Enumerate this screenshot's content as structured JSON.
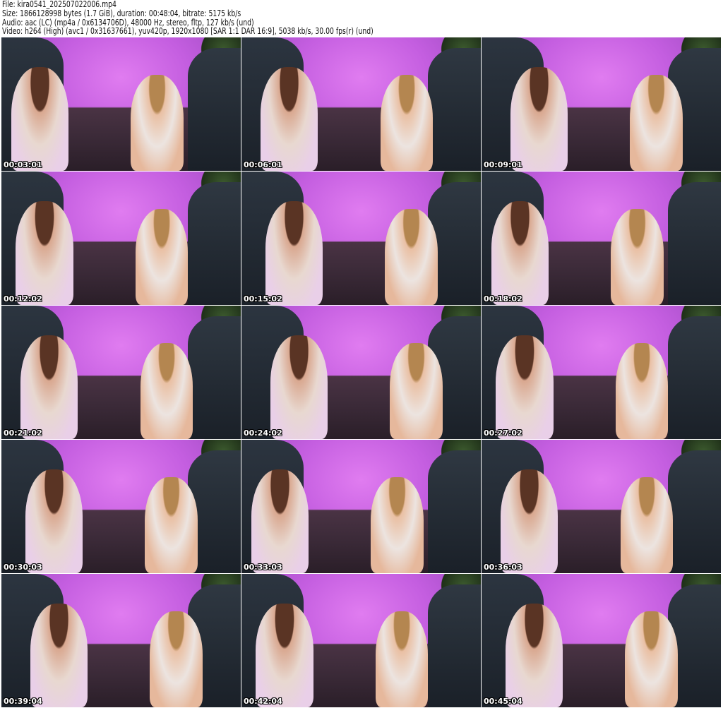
{
  "header": {
    "file": "File: kira0541_202507022006.mp4",
    "size": "Size: 1866128998 bytes (1.7 GiB), duration: 00:48:04, bitrate: 5175 kb/s",
    "audio": "Audio: aac (LC) (mp4a / 0x6134706D), 48000 Hz, stereo, fltp, 127 kb/s (und)",
    "video": "Video: h264 (High) (avc1 / 0x31637661), yuv420p, 1920x1080 [SAR 1:1 DAR 16:9], 5038 kb/s, 30.00 fps(r) (und)"
  },
  "thumbnails": [
    {
      "timestamp": "00:03:01"
    },
    {
      "timestamp": "00:06:01"
    },
    {
      "timestamp": "00:09:01"
    },
    {
      "timestamp": "00:12:02"
    },
    {
      "timestamp": "00:15:02"
    },
    {
      "timestamp": "00:18:02"
    },
    {
      "timestamp": "00:21:02"
    },
    {
      "timestamp": "00:24:02"
    },
    {
      "timestamp": "00:27:02"
    },
    {
      "timestamp": "00:30:03"
    },
    {
      "timestamp": "00:33:03"
    },
    {
      "timestamp": "00:36:03"
    },
    {
      "timestamp": "00:39:04"
    },
    {
      "timestamp": "00:42:04"
    },
    {
      "timestamp": "00:45:04"
    }
  ]
}
